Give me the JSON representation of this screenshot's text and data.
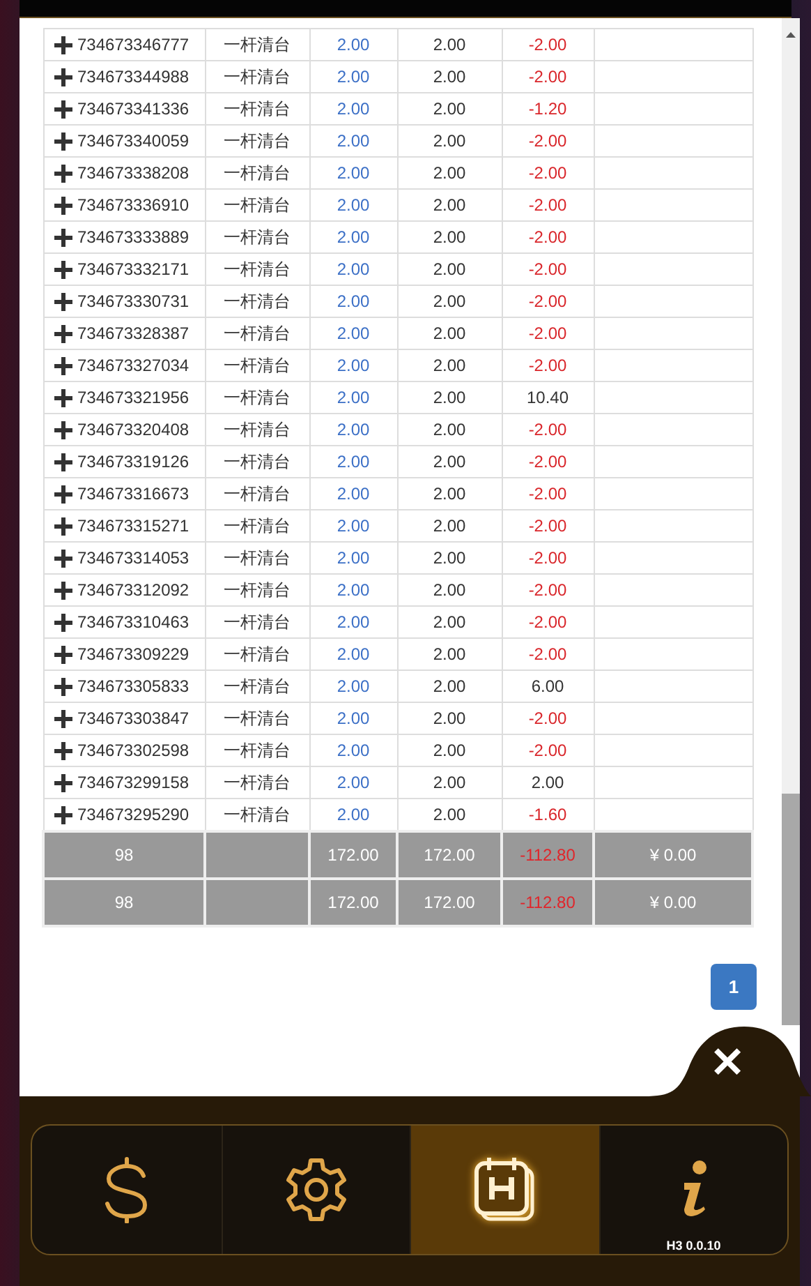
{
  "rows": [
    {
      "id": "734673346777",
      "type": "一杆清台",
      "bet": "2.00",
      "valid": "2.00",
      "result": "-2.00",
      "color": "#d9262b"
    },
    {
      "id": "734673344988",
      "type": "一杆清台",
      "bet": "2.00",
      "valid": "2.00",
      "result": "-2.00",
      "color": "#d9262b"
    },
    {
      "id": "734673341336",
      "type": "一杆清台",
      "bet": "2.00",
      "valid": "2.00",
      "result": "-1.20",
      "color": "#d9262b"
    },
    {
      "id": "734673340059",
      "type": "一杆清台",
      "bet": "2.00",
      "valid": "2.00",
      "result": "-2.00",
      "color": "#d9262b"
    },
    {
      "id": "734673338208",
      "type": "一杆清台",
      "bet": "2.00",
      "valid": "2.00",
      "result": "-2.00",
      "color": "#d9262b"
    },
    {
      "id": "734673336910",
      "type": "一杆清台",
      "bet": "2.00",
      "valid": "2.00",
      "result": "-2.00",
      "color": "#d9262b"
    },
    {
      "id": "734673333889",
      "type": "一杆清台",
      "bet": "2.00",
      "valid": "2.00",
      "result": "-2.00",
      "color": "#d9262b"
    },
    {
      "id": "734673332171",
      "type": "一杆清台",
      "bet": "2.00",
      "valid": "2.00",
      "result": "-2.00",
      "color": "#d9262b"
    },
    {
      "id": "734673330731",
      "type": "一杆清台",
      "bet": "2.00",
      "valid": "2.00",
      "result": "-2.00",
      "color": "#d9262b"
    },
    {
      "id": "734673328387",
      "type": "一杆清台",
      "bet": "2.00",
      "valid": "2.00",
      "result": "-2.00",
      "color": "#d9262b"
    },
    {
      "id": "734673327034",
      "type": "一杆清台",
      "bet": "2.00",
      "valid": "2.00",
      "result": "-2.00",
      "color": "#d9262b"
    },
    {
      "id": "734673321956",
      "type": "一杆清台",
      "bet": "2.00",
      "valid": "2.00",
      "result": "10.40",
      "color": "#333333"
    },
    {
      "id": "734673320408",
      "type": "一杆清台",
      "bet": "2.00",
      "valid": "2.00",
      "result": "-2.00",
      "color": "#d9262b"
    },
    {
      "id": "734673319126",
      "type": "一杆清台",
      "bet": "2.00",
      "valid": "2.00",
      "result": "-2.00",
      "color": "#d9262b"
    },
    {
      "id": "734673316673",
      "type": "一杆清台",
      "bet": "2.00",
      "valid": "2.00",
      "result": "-2.00",
      "color": "#d9262b"
    },
    {
      "id": "734673315271",
      "type": "一杆清台",
      "bet": "2.00",
      "valid": "2.00",
      "result": "-2.00",
      "color": "#d9262b"
    },
    {
      "id": "734673314053",
      "type": "一杆清台",
      "bet": "2.00",
      "valid": "2.00",
      "result": "-2.00",
      "color": "#d9262b"
    },
    {
      "id": "734673312092",
      "type": "一杆清台",
      "bet": "2.00",
      "valid": "2.00",
      "result": "-2.00",
      "color": "#d9262b"
    },
    {
      "id": "734673310463",
      "type": "一杆清台",
      "bet": "2.00",
      "valid": "2.00",
      "result": "-2.00",
      "color": "#d9262b"
    },
    {
      "id": "734673309229",
      "type": "一杆清台",
      "bet": "2.00",
      "valid": "2.00",
      "result": "-2.00",
      "color": "#d9262b"
    },
    {
      "id": "734673305833",
      "type": "一杆清台",
      "bet": "2.00",
      "valid": "2.00",
      "result": "6.00",
      "color": "#333333"
    },
    {
      "id": "734673303847",
      "type": "一杆清台",
      "bet": "2.00",
      "valid": "2.00",
      "result": "-2.00",
      "color": "#d9262b"
    },
    {
      "id": "734673302598",
      "type": "一杆清台",
      "bet": "2.00",
      "valid": "2.00",
      "result": "-2.00",
      "color": "#d9262b"
    },
    {
      "id": "734673299158",
      "type": "一杆清台",
      "bet": "2.00",
      "valid": "2.00",
      "result": "2.00",
      "color": "#333333"
    },
    {
      "id": "734673295290",
      "type": "一杆清台",
      "bet": "2.00",
      "valid": "2.00",
      "result": "-1.60",
      "color": "#d9262b"
    }
  ],
  "totals": [
    {
      "count": "98",
      "bet": "172.00",
      "valid": "172.00",
      "result": "-112.80",
      "balance": "¥ 0.00"
    },
    {
      "count": "98",
      "bet": "172.00",
      "valid": "172.00",
      "result": "-112.80",
      "balance": "¥ 0.00"
    }
  ],
  "pagination": [
    {
      "label": "1",
      "selected": true
    }
  ],
  "close": {
    "label": "✕"
  },
  "nav": [
    {
      "kind": "dollar",
      "selected": false
    },
    {
      "kind": "settings",
      "selected": false
    },
    {
      "kind": "history",
      "selected": true
    },
    {
      "kind": "info",
      "selected": false,
      "caption": "H3 0.0.10"
    }
  ]
}
